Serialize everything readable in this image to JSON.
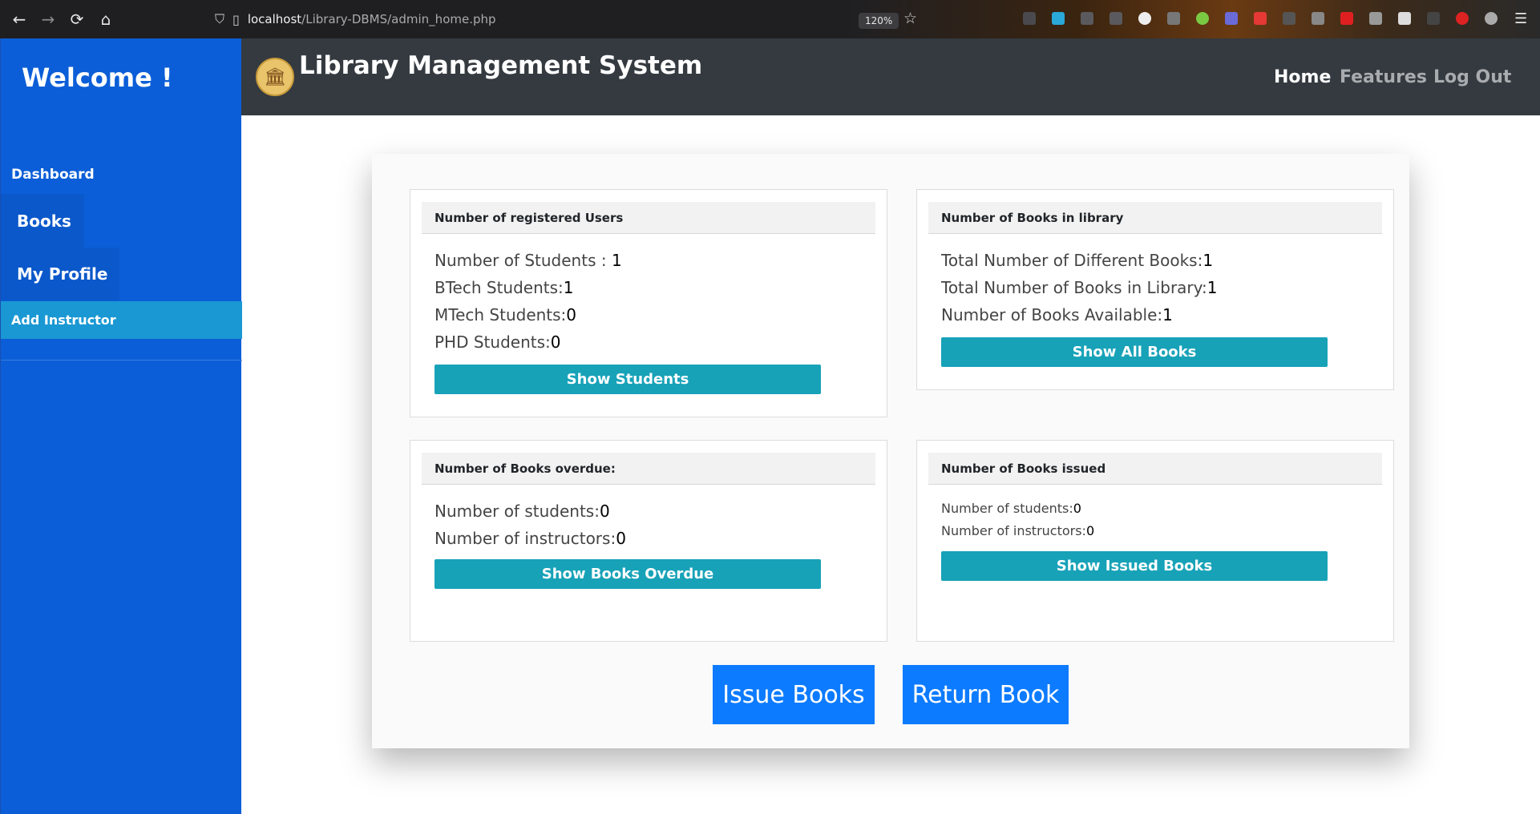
{
  "browser": {
    "back": "←",
    "forward": "→",
    "reload": "⟳",
    "home": "⌂",
    "url_host": "localhost",
    "url_path": "/Library-DBMS/admin_home.php",
    "zoom": "120%"
  },
  "sidebar": {
    "welcome": "Welcome !",
    "items": [
      {
        "label": "Dashboard"
      },
      {
        "label": "Books"
      },
      {
        "label": "My Profile"
      },
      {
        "label": "Add Instructor"
      }
    ]
  },
  "navbar": {
    "title": "Library Management System",
    "links": [
      {
        "label": "Home"
      },
      {
        "label": "Features"
      },
      {
        "label": "Log Out"
      }
    ]
  },
  "cards": {
    "users": {
      "header": "Number of registered Users",
      "lines": [
        {
          "label": "Number of Students : ",
          "value": "1"
        },
        {
          "label": "BTech Students:",
          "value": "1"
        },
        {
          "label": "MTech Students:",
          "value": "0"
        },
        {
          "label": "PHD Students:",
          "value": "0"
        }
      ],
      "button": "Show Students"
    },
    "books": {
      "header": "Number of Books in library",
      "lines": [
        {
          "label": "Total Number of Different Books:",
          "value": "1"
        },
        {
          "label": "Total Number of Books in Library:",
          "value": "1"
        },
        {
          "label": "Number of Books Available:",
          "value": "1"
        }
      ],
      "button": "Show All Books"
    },
    "overdue": {
      "header": "Number of Books overdue:",
      "lines": [
        {
          "label": "Number of students:",
          "value": "0"
        },
        {
          "label": "Number of instructors:",
          "value": "0"
        }
      ],
      "button": "Show Books Overdue"
    },
    "issued": {
      "header": "Number of Books issued",
      "lines": [
        {
          "label": "Number of students:",
          "value": "0"
        },
        {
          "label": "Number of instructors:",
          "value": "0"
        }
      ],
      "button": "Show Issued Books"
    }
  },
  "actions": {
    "issue": "Issue Books",
    "return": "Return Book"
  },
  "colors": {
    "sidebar": "#0b5ed7",
    "navbar": "#343a40",
    "teal_button": "#17a2b8",
    "primary_button": "#0d7bff",
    "active_sidebar_item": "#1a98d3"
  }
}
